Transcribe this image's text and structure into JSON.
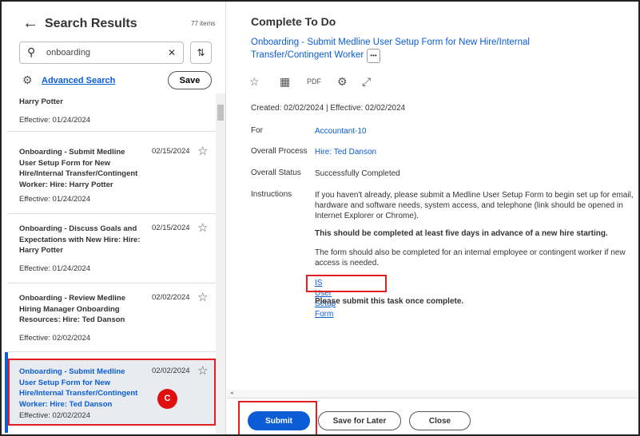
{
  "left": {
    "title": "Search Results",
    "count": "77 items",
    "search_value": "onboarding",
    "advanced_search": "Advanced Search",
    "save": "Save",
    "items": [
      {
        "title": "Harry Potter",
        "date": "",
        "effective": "Effective: 01/24/2024"
      },
      {
        "title": "Onboarding - Submit Medline User Setup Form for New Hire/Internal Transfer/Contingent Worker: Hire: Harry Potter",
        "date": "02/15/2024",
        "effective": "Effective: 01/24/2024"
      },
      {
        "title": "Onboarding - Discuss Goals and Expectations with New Hire: Hire: Harry Potter",
        "date": "02/15/2024",
        "effective": "Effective: 01/24/2024"
      },
      {
        "title": "Onboarding - Review Medline Hiring Manager Onboarding Resources: Hire: Ted Danson",
        "date": "02/02/2024",
        "effective": "Effective: 02/02/2024"
      },
      {
        "title": "Onboarding - Submit Medline User Setup Form for New Hire/Internal Transfer/Contingent Worker: Hire: Ted Danson",
        "date": "02/02/2024",
        "effective": "Effective: 02/02/2024",
        "selected": true
      }
    ],
    "callout": "C"
  },
  "right": {
    "title": "Complete To Do",
    "task_link": "Onboarding - Submit Medline User Setup Form for New Hire/Internal Transfer/Contingent Worker",
    "more": "•••",
    "created": "Created: 02/02/2024 | Effective: 02/02/2024",
    "for_label": "For",
    "for_value": "Accountant-10",
    "process_label": "Overall Process",
    "process_value": "Hire: Ted Danson",
    "status_label": "Overall Status",
    "status_value": "Successfully Completed",
    "instructions_label": "Instructions",
    "instr1": "If you haven't already, please submit a Medline User Setup Form to begin set up for email, hardware and software needs, system access, and telephone (link should be opened in Internet Explorer or Chrome).",
    "instr2": "This should be completed at least five days in advance of a new hire starting.",
    "instr3": "The form should also be completed for an internal employee or contingent worker if new access is needed.",
    "form_link": "IS User Setup Form",
    "instr4": "Please submit this task once complete.",
    "submit": "Submit",
    "save_later": "Save for Later",
    "close": "Close"
  },
  "colors": {
    "accent": "#0b5cd5",
    "highlight": "#e02020"
  }
}
